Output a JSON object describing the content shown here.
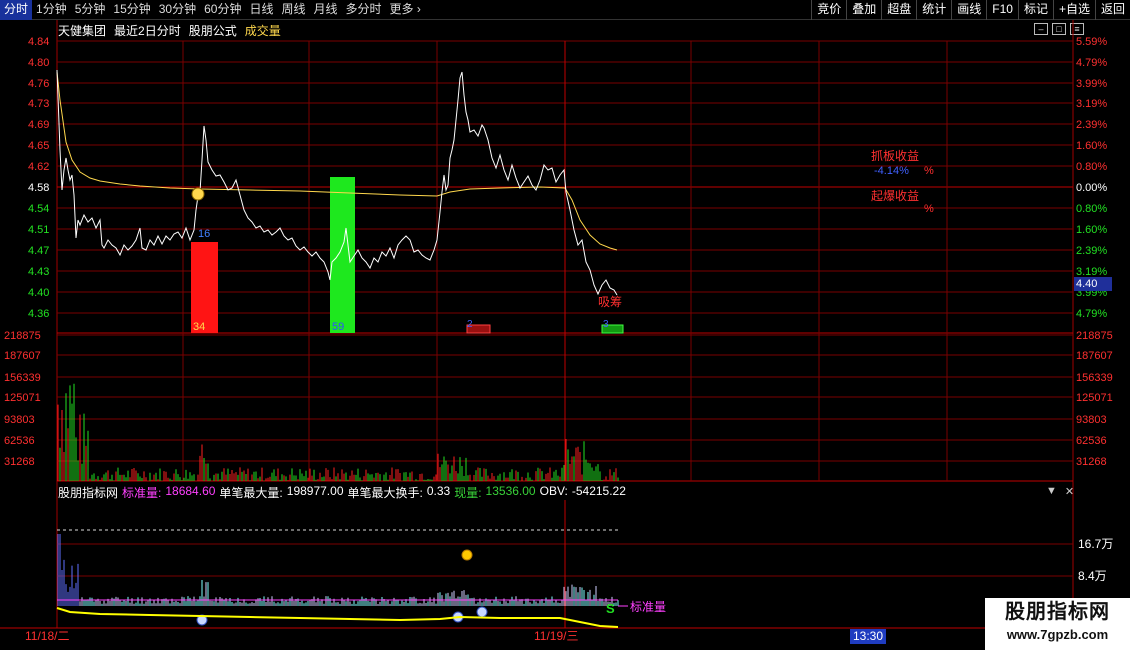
{
  "toolbar": {
    "tabs": [
      "分时",
      "1分钟",
      "5分钟",
      "15分钟",
      "30分钟",
      "60分钟",
      "日线",
      "周线",
      "月线",
      "多分时",
      "更多"
    ],
    "more_arrow": "›",
    "right": [
      "竞价",
      "叠加",
      "超盘",
      "统计",
      "画线",
      "F10",
      "标记",
      "+自选",
      "返回"
    ]
  },
  "info": {
    "stock": "天健集团",
    "period": "最近2日分时",
    "formula": "股朋公式",
    "volume": "成交量"
  },
  "price_axis": {
    "left": [
      "4.84",
      "4.80",
      "4.76",
      "4.73",
      "4.69",
      "4.65",
      "4.62",
      "4.58",
      "4.54",
      "4.51",
      "4.47",
      "4.43",
      "4.40",
      "4.36"
    ],
    "right": [
      "5.59%",
      "4.79%",
      "3.99%",
      "3.19%",
      "2.39%",
      "1.60%",
      "0.80%",
      "0.00%",
      "0.80%",
      "1.60%",
      "2.39%",
      "3.19%",
      "3.99%",
      "4.79%"
    ],
    "current_price": "4.40"
  },
  "volume_axis": [
    "218875",
    "187607",
    "156339",
    "125071",
    "93803",
    "62536",
    "31268"
  ],
  "annotations": {
    "bar1_top": "16",
    "bar1_bottom": "34",
    "bar2_bottom": "59",
    "small1": "2",
    "small2": "3",
    "xixu": "吸筹",
    "zhuaban": "抓板收益",
    "zhuaban_val": "-4.14%",
    "pct": "%",
    "qibao": "起爆收益",
    "qibao_pct": "%"
  },
  "indicator": {
    "name": "股朋指标网",
    "std_label": "标准量:",
    "std_value": "18684.60",
    "max_vol_label": "单笔最大量:",
    "max_vol_value": "198977.00",
    "max_turn_label": "单笔最大换手:",
    "max_turn_value": "0.33",
    "cur_label": "现量:",
    "cur_value": "13536.00",
    "obv_label": "OBV:",
    "obv_value": "-54215.22",
    "axis": [
      "16.7万",
      "8.4万"
    ],
    "std_line_label": "标准量",
    "marker": "S"
  },
  "time_axis": {
    "day1": "11/18/二",
    "day2": "11/19/三",
    "current": "13:30"
  },
  "brand": {
    "name": "股朋指标网",
    "url": "www.7gpzb.com"
  },
  "colors": {
    "grid": "#7a0000",
    "price": "#ffffff",
    "avg": "#ffd84d",
    "up": "#ff2020",
    "down": "#22e022",
    "std": "#ff40ff"
  }
}
